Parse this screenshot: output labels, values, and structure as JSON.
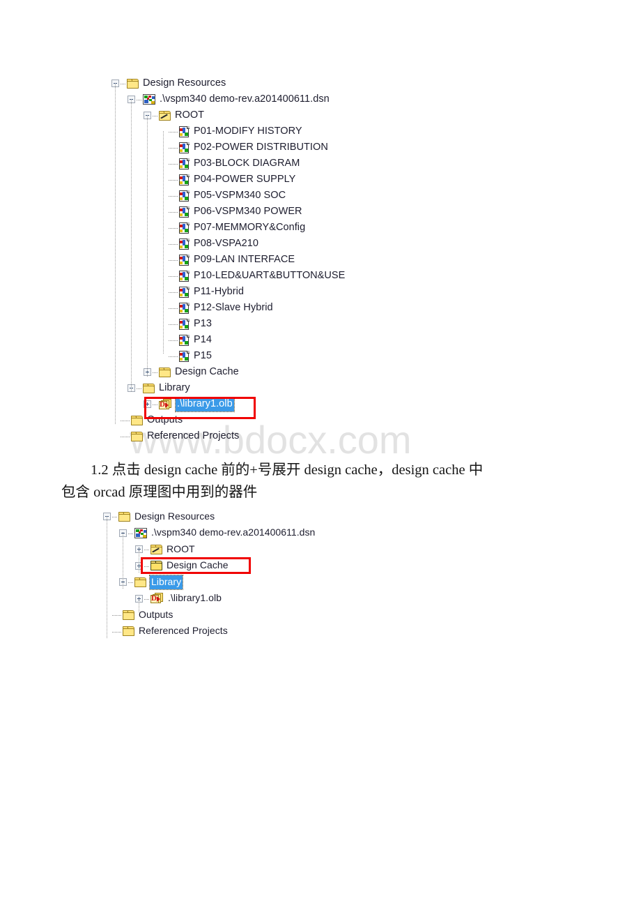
{
  "watermark": {
    "text": "www.bdocx.com"
  },
  "paragraph": {
    "line1": "1.2 点击 design cache 前的+号展开 design cache，design cache 中",
    "line2": "包含 orcad 原理图中用到的器件"
  },
  "tree_one": {
    "name": "design-resources-tree-expanded",
    "rows": [
      {
        "label": "Design Resources",
        "icon": "folder-icon",
        "expander": "minus",
        "depth": 0
      },
      {
        "label": ".\\vspm340 demo-rev.a201400611.dsn",
        "icon": "dsn-file-icon",
        "expander": "minus",
        "depth": 1
      },
      {
        "label": "ROOT",
        "icon": "root-folder-icon",
        "expander": "minus",
        "depth": 2
      },
      {
        "label": "P01-MODIFY HISTORY",
        "icon": "schematic-page-icon",
        "expander": "none",
        "depth": 3
      },
      {
        "label": "P02-POWER DISTRIBUTION",
        "icon": "schematic-page-icon",
        "expander": "none",
        "depth": 3
      },
      {
        "label": "P03-BLOCK DIAGRAM",
        "icon": "schematic-page-icon",
        "expander": "none",
        "depth": 3
      },
      {
        "label": "P04-POWER SUPPLY",
        "icon": "schematic-page-icon",
        "expander": "none",
        "depth": 3
      },
      {
        "label": "P05-VSPM340 SOC",
        "icon": "schematic-page-icon",
        "expander": "none",
        "depth": 3
      },
      {
        "label": "P06-VSPM340 POWER",
        "icon": "schematic-page-icon",
        "expander": "none",
        "depth": 3
      },
      {
        "label": "P07-MEMMORY&Config",
        "icon": "schematic-page-icon",
        "expander": "none",
        "depth": 3
      },
      {
        "label": "P08-VSPA210",
        "icon": "schematic-page-icon",
        "expander": "none",
        "depth": 3
      },
      {
        "label": "P09-LAN INTERFACE",
        "icon": "schematic-page-icon",
        "expander": "none",
        "depth": 3
      },
      {
        "label": "P10-LED&UART&BUTTON&USE",
        "icon": "schematic-page-icon",
        "expander": "none",
        "depth": 3
      },
      {
        "label": "P11-Hybrid",
        "icon": "schematic-page-icon",
        "expander": "none",
        "depth": 3
      },
      {
        "label": "P12-Slave Hybrid",
        "icon": "schematic-page-icon",
        "expander": "none",
        "depth": 3
      },
      {
        "label": "P13",
        "icon": "schematic-page-icon",
        "expander": "none",
        "depth": 3
      },
      {
        "label": "P14",
        "icon": "schematic-page-icon",
        "expander": "none",
        "depth": 3
      },
      {
        "label": "P15",
        "icon": "schematic-page-icon",
        "expander": "none",
        "depth": 3
      },
      {
        "label": "Design Cache",
        "icon": "folder-icon",
        "expander": "plus",
        "depth": 2
      },
      {
        "label": "Library",
        "icon": "folder-icon",
        "expander": "minus",
        "depth": 1
      },
      {
        "label": ".\\library1.olb",
        "icon": "olb-library-icon",
        "expander": "plus",
        "depth": 2,
        "selected": true
      },
      {
        "label": "Outputs",
        "icon": "folder-icon",
        "expander": "none",
        "depth": 0
      },
      {
        "label": "Referenced Projects",
        "icon": "folder-icon",
        "expander": "none",
        "depth": 0
      }
    ]
  },
  "tree_two": {
    "name": "design-resources-tree-collapsed",
    "rows": [
      {
        "label": "Design Resources",
        "icon": "folder-icon",
        "expander": "minus",
        "depth": 0
      },
      {
        "label": ".\\vspm340 demo-rev.a201400611.dsn",
        "icon": "dsn-file-icon",
        "expander": "minus",
        "depth": 1
      },
      {
        "label": "ROOT",
        "icon": "root-folder-icon",
        "expander": "plus",
        "depth": 2
      },
      {
        "label": "Design Cache",
        "icon": "folder-icon-closed",
        "expander": "plus",
        "depth": 2
      },
      {
        "label": "Library",
        "icon": "folder-icon",
        "expander": "minus",
        "depth": 1,
        "selected": true
      },
      {
        "label": ".\\library1.olb",
        "icon": "olb-library-icon",
        "expander": "plus",
        "depth": 2
      },
      {
        "label": "Outputs",
        "icon": "folder-icon",
        "expander": "none",
        "depth": 0
      },
      {
        "label": "Referenced Projects",
        "icon": "folder-icon",
        "expander": "none",
        "depth": 0
      }
    ]
  },
  "annotations": [
    {
      "name": "red-highlight-library1-olb",
      "color": "#f00000"
    },
    {
      "name": "red-highlight-design-cache",
      "color": "#f00000"
    }
  ]
}
